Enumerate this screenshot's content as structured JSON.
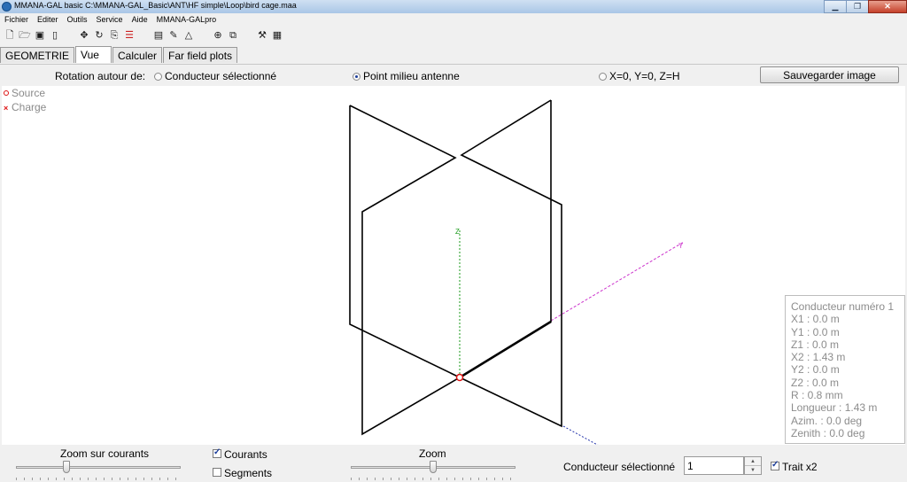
{
  "window": {
    "title": "MMANA-GAL basic C:\\MMANA-GAL_Basic\\ANT\\HF simple\\Loop\\bird cage.maa",
    "minimize_icon": "minimize-icon",
    "maximize_icon": "maximize-icon",
    "close_icon": "close-icon"
  },
  "menu": [
    "Fichier",
    "Editer",
    "Outils",
    "Service",
    "Aide",
    "MMANA-GALpro"
  ],
  "toolbar_icons": [
    "new-file-icon",
    "open-folder-icon",
    "save-disk-icon",
    "info-icon",
    "move-cross-icon",
    "rotate-icon",
    "copy-icon",
    "align-icon",
    "document-icon",
    "edit-icon",
    "triangle-icon",
    "crosshair-icon",
    "duplicate-icon",
    "tools-icon",
    "calculator-icon"
  ],
  "tabs": [
    {
      "label": "GEOMETRIE",
      "active": false
    },
    {
      "label": "Vue",
      "active": true
    },
    {
      "label": "Calculer",
      "active": false
    },
    {
      "label": "Far field plots",
      "active": false
    }
  ],
  "options": {
    "rotation_label": "Rotation autour de:",
    "radio_selected_conductor": "Conducteur sélectionné",
    "radio_antenna_center": "Point milieu antenne",
    "radio_origin": "X=0, Y=0, Z=H",
    "selected": "antenna_center",
    "save_button": "Sauvegarder image"
  },
  "legend": {
    "source": "Source",
    "charge": "Charge",
    "source_color": "#dd1111",
    "charge_color": "#dd1111"
  },
  "conductor_info": {
    "title": "Conducteur numéro 1",
    "rows": [
      "X1   :  0.0 m",
      "Y1   :  0.0 m",
      "Z1   :  0.0 m",
      "X2   :  1.43 m",
      "Y2   :  0.0 m",
      "Z2   :  0.0 m",
      "R    :  0.8 mm",
      "Longueur : 1.43 m",
      "Azim. : 0.0 deg",
      "Zenith : 0.0 deg"
    ]
  },
  "bottom": {
    "zoom_currents_label": "Zoom sur courants",
    "zoom_currents_value": 0.3,
    "currents_label": "Courants",
    "currents_checked": true,
    "segments_label": "Segments",
    "segments_checked": false,
    "zoom_label": "Zoom",
    "zoom_value": 0.5,
    "selected_conductor_label": "Conducteur sélectionné",
    "selected_conductor_value": "1",
    "double_line_label": "Trait x2",
    "double_line_checked": true
  },
  "colors": {
    "wire": "#000000",
    "axis_z": "#1a9a1a",
    "axis_y": "#cc33cc",
    "axis_x": "#2233aa",
    "feed_marker": "#dd1111"
  },
  "axis_labels": {
    "z": "Z",
    "y": "Y"
  }
}
